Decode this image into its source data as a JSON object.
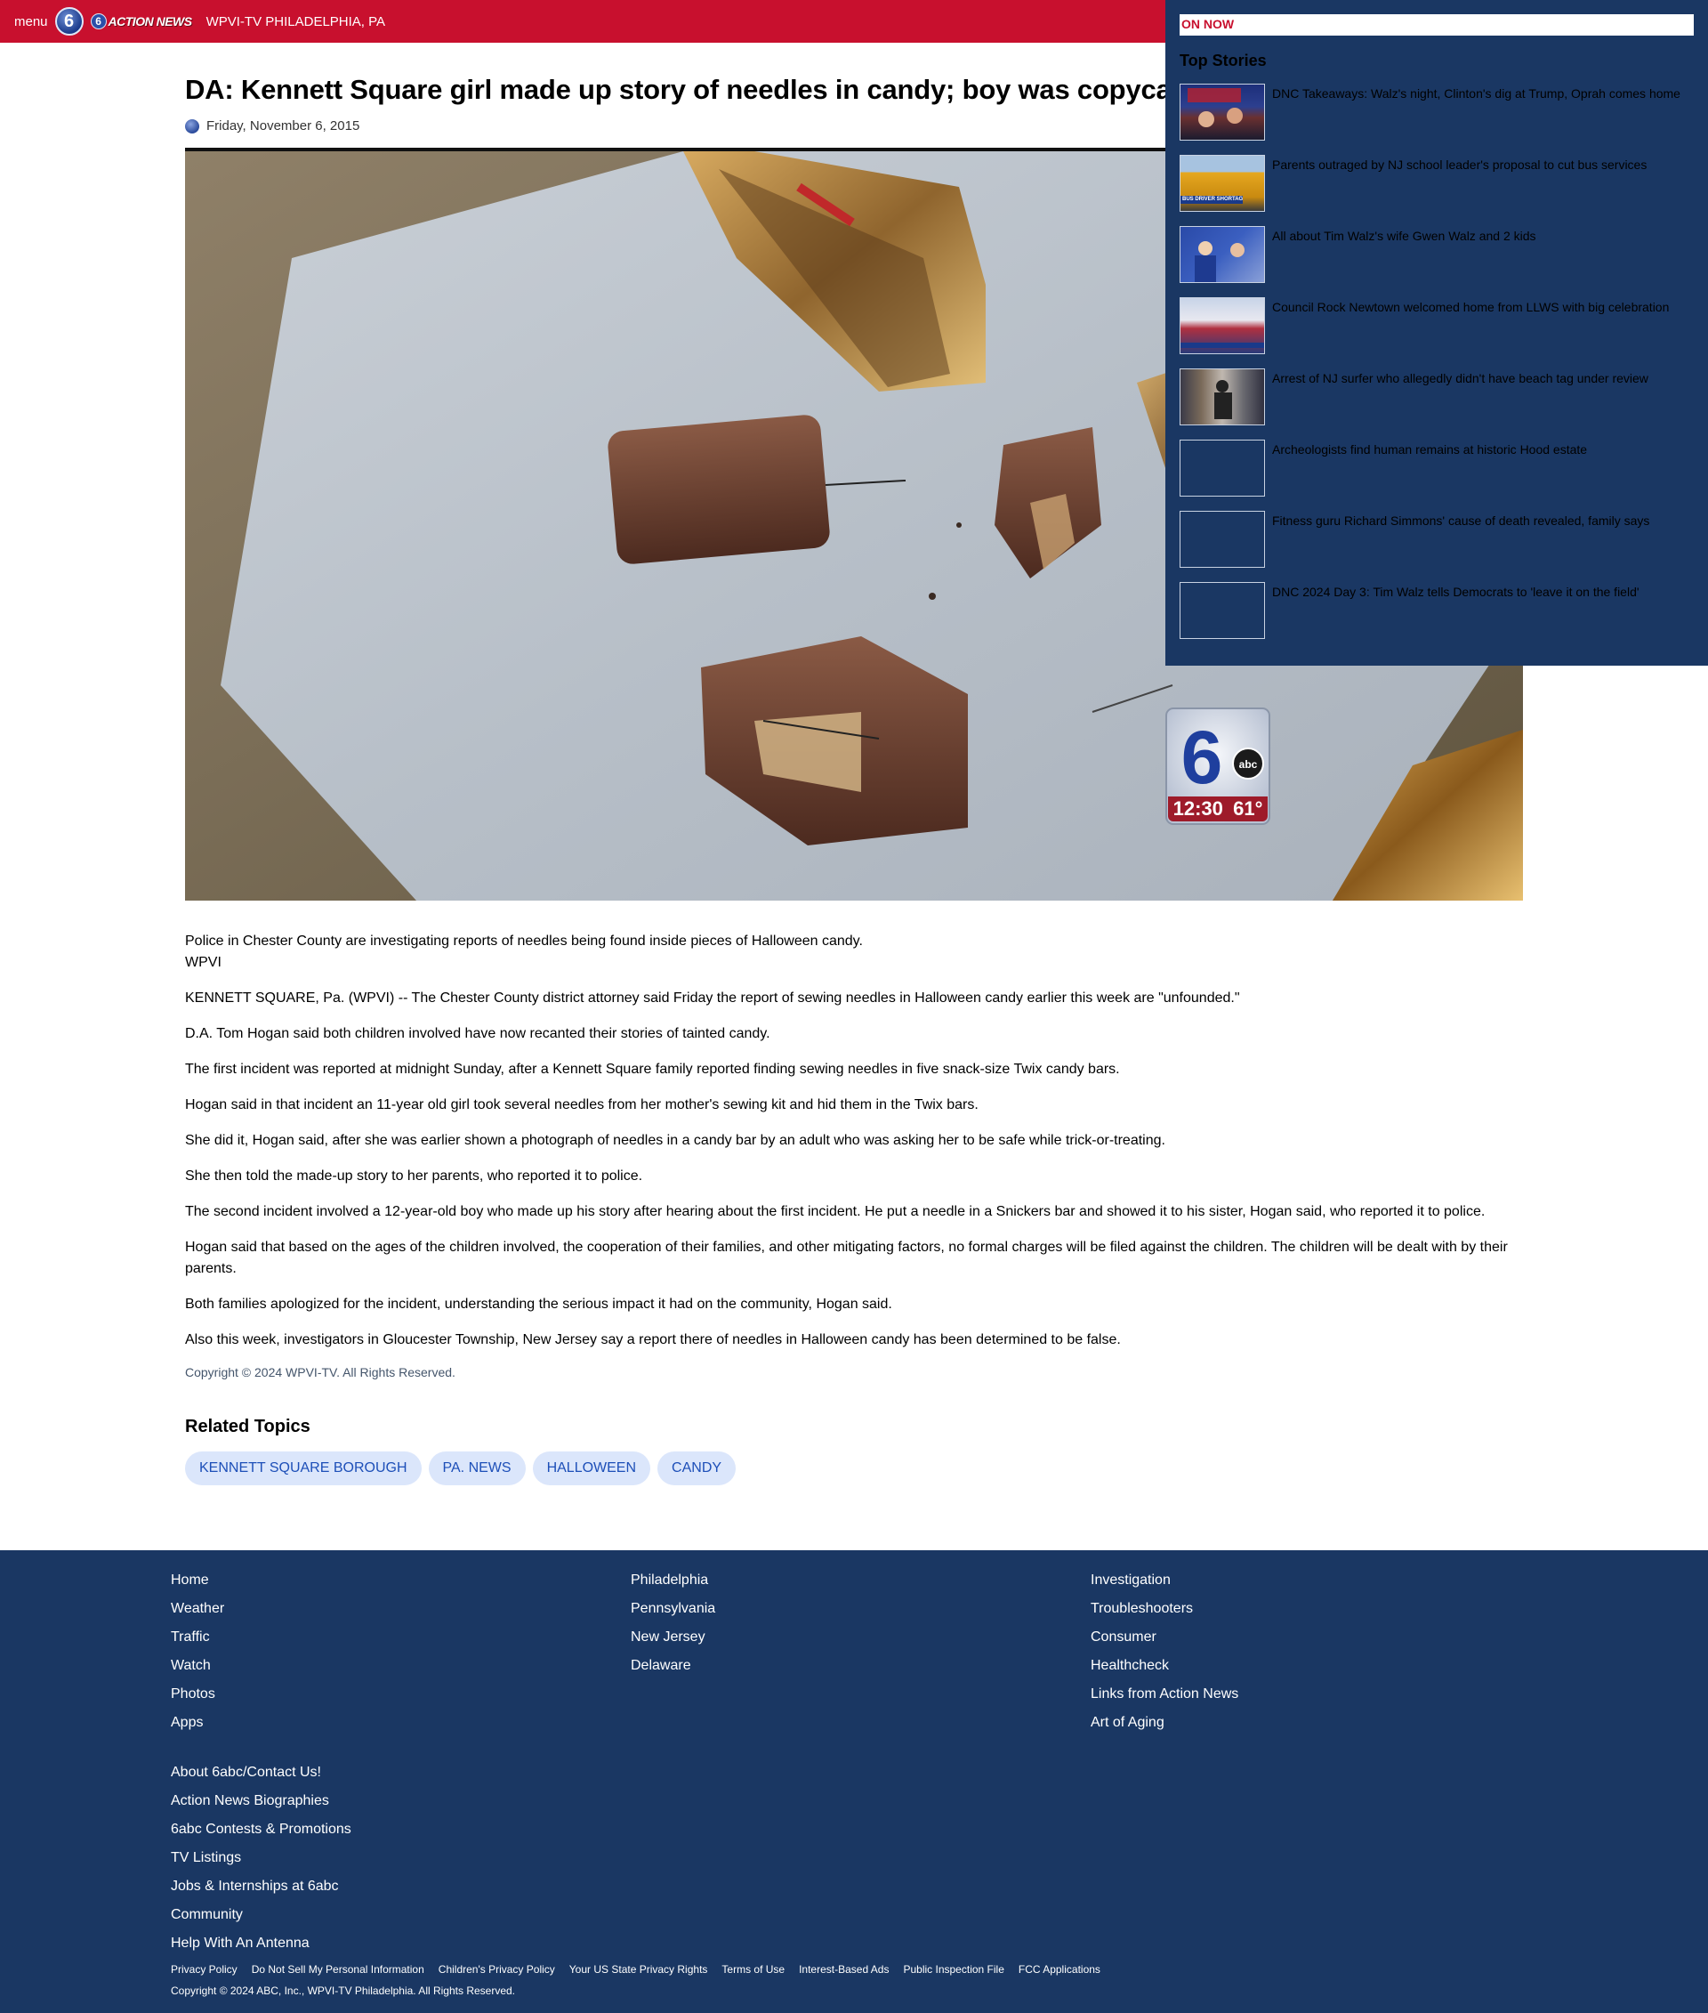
{
  "header": {
    "menu_label": "menu",
    "logo_number": "6",
    "brand_logo_text": "ACTION NEWS",
    "station": "WPVI-TV PHILADELPHIA, PA"
  },
  "article": {
    "headline": "DA: Kennett Square girl made up story of needles in candy; boy was copycat",
    "date": "Friday, November 6, 2015",
    "image_bug_time": "12:30",
    "image_bug_temp": "61°",
    "image_bug_logo": "abc",
    "caption": "Police in Chester County are investigating reports of needles being found inside pieces of Halloween candy.",
    "credit": "WPVI",
    "paragraphs": [
      "KENNETT SQUARE, Pa. (WPVI) -- The Chester County district attorney said Friday the report of sewing needles in Halloween candy earlier this week are \"unfounded.\"",
      "D.A. Tom Hogan said both children involved have now recanted their stories of tainted candy.",
      "The first incident was reported at midnight Sunday, after a Kennett Square family reported finding sewing needles in five snack-size Twix candy bars.",
      "Hogan said in that incident an 11-year old girl took several needles from her mother's sewing kit and hid them in the Twix bars.",
      "She did it, Hogan said, after she was earlier shown a photograph of needles in a candy bar by an adult who was asking her to be safe while trick-or-treating.",
      "She then told the made-up story to her parents, who reported it to police.",
      "The second incident involved a 12-year-old boy who made up his story after hearing about the first incident. He put a needle in a Snickers bar and showed it to his sister, Hogan said, who reported it to police.",
      "Hogan said that based on the ages of the children involved, the cooperation of their families, and other mitigating factors, no formal charges will be filed against the children. The children will be dealt with by their parents.",
      "Both families apologized for the incident, understanding the serious impact it had on the community, Hogan said.",
      "Also this week, investigators in Gloucester Township, New Jersey say a report there of needles in Halloween candy has been determined to be false."
    ],
    "copyright": "Copyright © 2024 WPVI-TV. All Rights Reserved.",
    "related_title": "Related Topics",
    "related_topics": [
      "Kennett Square Borough",
      "Pa. News",
      "Halloween",
      "Candy"
    ]
  },
  "sidebar": {
    "on_now": "ON NOW",
    "title": "Top Stories",
    "stories": [
      {
        "text": "DNC Takeaways: Walz's night, Clinton's dig at Trump, Oprah comes home",
        "thumb": "crowd"
      },
      {
        "text": "Parents outraged by NJ school leader's proposal to cut bus services",
        "thumb": "bus",
        "thumb_caption": "BUS DRIVER SHORTAGE"
      },
      {
        "text": "All about Tim Walz's wife Gwen Walz and 2 kids",
        "thumb": "stage"
      },
      {
        "text": "Council Rock Newtown welcomed home from LLWS with big celebration",
        "thumb": "celebration"
      },
      {
        "text": "Arrest of NJ surfer who allegedly didn't have beach tag under review",
        "thumb": "beach"
      },
      {
        "text": "Archeologists find human remains at historic Hood estate",
        "thumb": "empty"
      },
      {
        "text": "Fitness guru Richard Simmons' cause of death revealed, family says",
        "thumb": "empty"
      },
      {
        "text": "DNC 2024 Day 3: Tim Walz tells Democrats to 'leave it on the field'",
        "thumb": "empty"
      }
    ]
  },
  "footer": {
    "col1": [
      "Home",
      "Weather",
      "Traffic",
      "Watch",
      "Photos",
      "Apps"
    ],
    "col2": [
      "Philadelphia",
      "Pennsylvania",
      "New Jersey",
      "Delaware"
    ],
    "col3": [
      "Investigation",
      "Troubleshooters",
      "Consumer",
      "Healthcheck",
      "Links from Action News",
      "Art of Aging"
    ],
    "extra": [
      "About 6abc/Contact Us!",
      "Action News Biographies",
      "6abc Contests & Promotions",
      "TV Listings",
      "Jobs & Internships at 6abc",
      "Community",
      "Help With An Antenna"
    ],
    "legal": [
      "Privacy Policy",
      "Do Not Sell My Personal Information",
      "Children's Privacy Policy",
      "Your US State Privacy Rights",
      "Terms of Use",
      "Interest-Based Ads",
      "Public Inspection File",
      "FCC Applications"
    ],
    "copyright": "Copyright © 2024 ABC, Inc., WPVI-TV Philadelphia. All Rights Reserved."
  }
}
